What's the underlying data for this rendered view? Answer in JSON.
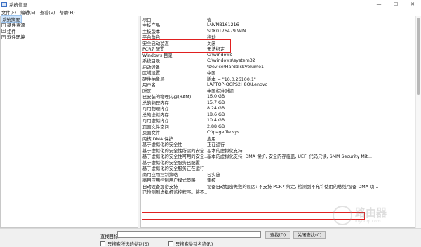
{
  "window": {
    "title": "系统信息",
    "controls": {
      "minimize": "—",
      "maximize": "☐",
      "close": "✕"
    }
  },
  "menu": [
    "文件(F)",
    "编辑(E)",
    "查看(V)",
    "帮助(H)"
  ],
  "tree": [
    {
      "label": "系统摘要",
      "expander": "",
      "selected": true
    },
    {
      "label": "硬件资源",
      "expander": "+"
    },
    {
      "label": "组件",
      "expander": "+"
    },
    {
      "label": "软件环境",
      "expander": "+"
    }
  ],
  "grid": {
    "header": {
      "item": "项目",
      "value": "值"
    },
    "rows": [
      {
        "item": "主板产品",
        "value": "LNVNB161216"
      },
      {
        "item": "主板版本",
        "value": "SDK0T76479 WIN"
      },
      {
        "item": "平台角色",
        "value": "移动"
      },
      {
        "item": "安全启动状态",
        "value": "关闭"
      },
      {
        "item": "PCR7 配置",
        "value": "无法绑定"
      },
      {
        "item": "Windows 目录",
        "value": "C:\\windows"
      },
      {
        "item": "系统目录",
        "value": "C:\\windows\\system32"
      },
      {
        "item": "启动设备",
        "value": "\\Device\\HarddiskVolume1"
      },
      {
        "item": "区域设置",
        "value": "中国"
      },
      {
        "item": "硬件抽象层",
        "value": "版本 = \"10.0.26100.1\""
      },
      {
        "item": "用户名",
        "value": "LAPTOP-QCPS2H8O\\Lenovo"
      },
      {
        "item": "时区",
        "value": "中国标准时间"
      },
      {
        "item": "已安装的物理内存(RAM)",
        "value": "16.0 GB"
      },
      {
        "item": "总的物理内存",
        "value": "15.7 GB"
      },
      {
        "item": "可用物理内存",
        "value": "8.24 GB"
      },
      {
        "item": "总的虚拟内存",
        "value": "18.6 GB"
      },
      {
        "item": "可用虚拟内存",
        "value": "10.4 GB"
      },
      {
        "item": "页面文件空间",
        "value": "2.88 GB"
      },
      {
        "item": "页面文件",
        "value": "C:\\pagefile.sys"
      },
      {
        "item": "内核 DMA 保护",
        "value": "启用"
      },
      {
        "item": "基于虚拟化的安全性",
        "value": "正在运行"
      },
      {
        "item": "基于虚拟化的安全性所需的安全...",
        "value": "基本的虚拟化支持"
      },
      {
        "item": "基于虚拟化的安全性可用的安全...",
        "value": "基本的虚拟化支持, DMA 保护, 安全内存覆盖, UEFI 代码只读, SMM Security Mit..."
      },
      {
        "item": "基于虚拟化的安全服务已配置",
        "value": ""
      },
      {
        "item": "基于虚拟化的安全服务正在运行",
        "value": ""
      },
      {
        "item": "商用应用控制策略",
        "value": "已实施"
      },
      {
        "item": "商用应用控制用户模式策略",
        "value": "审核"
      },
      {
        "item": "自动设备加密支持",
        "value": "设备自动加密失败的原因: 不支持 PCR7 绑定, 检测到不允许使用的总线/设备 DMA 功..."
      },
      {
        "item": "已检测到虚拟机监控程序。将不...",
        "value": ""
      }
    ]
  },
  "find": {
    "label": "查找目标:",
    "value": "",
    "find_button": "查找(D)",
    "close_button": "关闭查找(C)",
    "checkbox1": "只搜索所选的类别(S)",
    "checkbox2": "只搜索类别名称(R)"
  },
  "watermark": {
    "big": "路由器",
    "small": "luyouqi.com"
  },
  "colors": {
    "highlight": "#e02020",
    "selection": "#cce4f7"
  }
}
